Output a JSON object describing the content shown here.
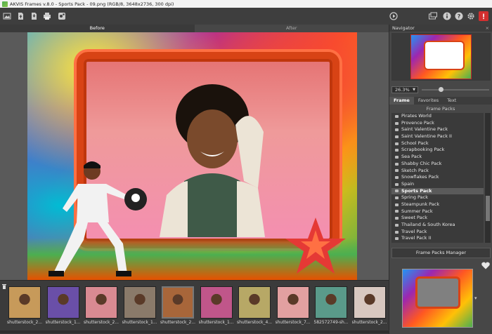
{
  "window": {
    "title": "AKVIS Frames v.8.0 - Sports Pack - 09.png (RGB/8, 3648x2736, 300 dpi)"
  },
  "toolbar": {
    "left_icons": [
      "open-image-icon",
      "open-file-icon",
      "save-icon",
      "print-icon",
      "share-icon"
    ],
    "right_icons": [
      "run-icon",
      "panels-icon",
      "info-icon",
      "help-icon",
      "settings-icon",
      "notifications-icon"
    ]
  },
  "view_tabs": {
    "before": "Before",
    "after": "After"
  },
  "navigator": {
    "title": "Navigator",
    "close": "×",
    "zoom": "26.3%"
  },
  "panel_tabs": [
    "Frame",
    "Favorites",
    "Text"
  ],
  "frame_packs": {
    "title": "Frame Packs",
    "items": [
      "Pirates World",
      "Provence Pack",
      "Saint Valentine Pack",
      "Saint Valentine Pack II",
      "School Pack",
      "Scrapbooking Pack",
      "Sea Pack",
      "Shabby Chic Pack",
      "Sketch Pack",
      "Snowflakes Pack",
      "Spain",
      "Sports Pack",
      "Spring Pack",
      "Steampunk Pack",
      "Summer Pack",
      "Sweet Pack",
      "Thailand & South Korea",
      "Travel Pack",
      "Travel Pack II"
    ],
    "selected": "Sports Pack",
    "manager_button": "Frame Packs Manager"
  },
  "thumbnails": [
    {
      "caption": "shutterstock_2...",
      "color": "#c79a5a"
    },
    {
      "caption": "shutterstock_1...",
      "color": "#6a4fa8"
    },
    {
      "caption": "shutterstock_2...",
      "color": "#d98a92"
    },
    {
      "caption": "shutterstock_1...",
      "color": "#8a7a6a"
    },
    {
      "caption": "shutterstock_2...",
      "color": "#a8663a"
    },
    {
      "caption": "shutterstock_1...",
      "color": "#c0568a"
    },
    {
      "caption": "shutterstock_4...",
      "color": "#b7a866"
    },
    {
      "caption": "shutterstock_7...",
      "color": "#e2a0a0"
    },
    {
      "caption": "582572749-sh...",
      "color": "#5a9a8a"
    },
    {
      "caption": "shutterstock_2...",
      "color": "#d8c8c0"
    }
  ]
}
